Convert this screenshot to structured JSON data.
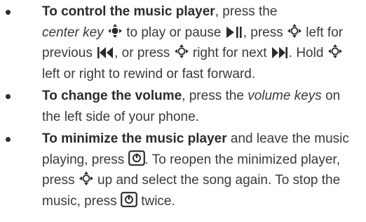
{
  "items": [
    {
      "lead": "To control the music player",
      "t1": ", press the",
      "key_name": "center key",
      "t2": " to play or pause ",
      "t3": ", press ",
      "t4": " left for previous ",
      "t5": ", or press ",
      "t6": " right for next ",
      "t7": ". Hold ",
      "t8": " left or right to rewind or fast forward."
    },
    {
      "lead": "To change the volume",
      "t1": ", press the ",
      "key_name": "volume keys",
      "t2": " on the left side of your phone."
    },
    {
      "lead": "To minimize the music player",
      "t1": " and leave the music playing, press ",
      "t2": ". To reopen the minimized player, press ",
      "t3": " up and select the song again. To stop the music, press ",
      "t4": " twice."
    }
  ],
  "icons": {
    "center_key": "center-key-icon",
    "nav_key": "nav-key-icon",
    "play_pause": "play-pause-icon",
    "previous": "previous-track-icon",
    "next": "next-track-icon",
    "home_key": "home-key-icon"
  }
}
